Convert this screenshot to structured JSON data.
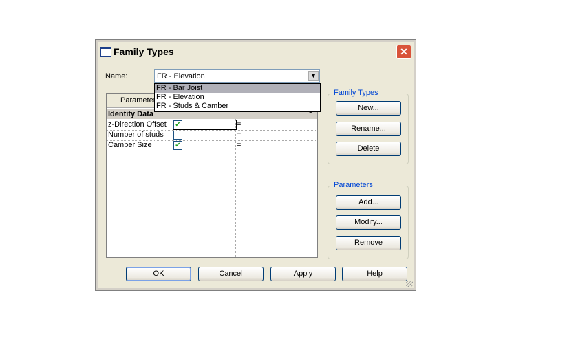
{
  "title": "Family Types",
  "name_label": "Name:",
  "name_value": "FR - Elevation",
  "dropdown_options": [
    "FR - Bar Joist",
    "FR - Elevation",
    "FR - Studs & Camber"
  ],
  "grid": {
    "header": "Parameter",
    "group": "Identity Data",
    "rows": [
      {
        "name": "z-Direction Offset",
        "checked": true,
        "formula": "="
      },
      {
        "name": "Number of studs",
        "checked": false,
        "formula": "="
      },
      {
        "name": "Camber Size",
        "checked": true,
        "formula": "="
      }
    ]
  },
  "family_types": {
    "legend": "Family Types",
    "new": "New...",
    "rename": "Rename...",
    "delete": "Delete"
  },
  "parameters": {
    "legend": "Parameters",
    "add": "Add...",
    "modify": "Modify...",
    "remove": "Remove"
  },
  "footer": {
    "ok": "OK",
    "cancel": "Cancel",
    "apply": "Apply",
    "help": "Help"
  },
  "check_glyph": "✔",
  "close_glyph": "✕",
  "collapse_glyph": "⌃"
}
